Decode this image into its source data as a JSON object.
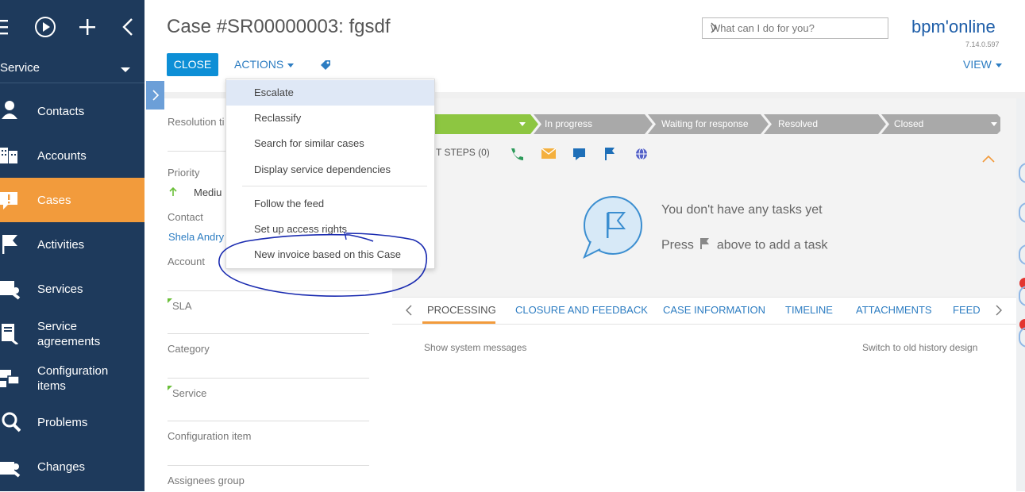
{
  "sidebar": {
    "workplace": "Service",
    "items": [
      {
        "label": "Contacts",
        "icon": "contacts-icon"
      },
      {
        "label": "Accounts",
        "icon": "accounts-icon"
      },
      {
        "label": "Cases",
        "icon": "cases-icon",
        "active": true
      },
      {
        "label": "Activities",
        "icon": "activities-icon"
      },
      {
        "label": "Services",
        "icon": "services-icon"
      },
      {
        "label": "Service agreements",
        "icon": "service-agreements-icon"
      },
      {
        "label": "Configuration items",
        "icon": "configuration-items-icon"
      },
      {
        "label": "Problems",
        "icon": "problems-icon"
      },
      {
        "label": "Changes",
        "icon": "changes-icon"
      }
    ],
    "accent_color": "#f29b3c",
    "bg_color": "#1e3a5c"
  },
  "header": {
    "title": "Case #SR00000003: fgsdf",
    "close_label": "CLOSE",
    "actions_label": "ACTIONS",
    "view_label": "VIEW",
    "search_placeholder": "What can I do for you?",
    "logo": "bpm'online",
    "version": "7.14.0.597"
  },
  "actions_menu": {
    "items": [
      "Escalate",
      "Reclassify",
      "Search for similar cases",
      "Display service dependencies",
      "Follow the feed",
      "Set up access rights",
      "New invoice based on this Case"
    ],
    "highlighted": "Escalate"
  },
  "fields": {
    "resolution_time_label": "Resolution ti",
    "priority_label": "Priority",
    "priority_value": "Mediu",
    "contact_label": "Contact",
    "contact_value": "Shela Andry",
    "account_label": "Account",
    "sla_label": "SLA",
    "category_label": "Category",
    "service_label": "Service",
    "configuration_item_label": "Configuration item",
    "assignees_group_label": "Assignees group"
  },
  "stages": [
    "In progress",
    "Waiting for response",
    "Resolved",
    "Closed"
  ],
  "stage_colors": {
    "active": "#8dc641",
    "inactive": "#a9a9a9"
  },
  "next_steps": {
    "label": "T STEPS (0)",
    "empty_title": "You don't have any tasks yet",
    "empty_hint_press": "Press",
    "empty_hint_rest": "above to add a task"
  },
  "tabs": [
    "PROCESSING",
    "CLOSURE AND FEEDBACK",
    "CASE INFORMATION",
    "TIMELINE",
    "ATTACHMENTS",
    "FEED"
  ],
  "active_tab": "PROCESSING",
  "processing": {
    "show_system_messages": "Show system messages",
    "switch_old_history": "Switch to old history design"
  }
}
